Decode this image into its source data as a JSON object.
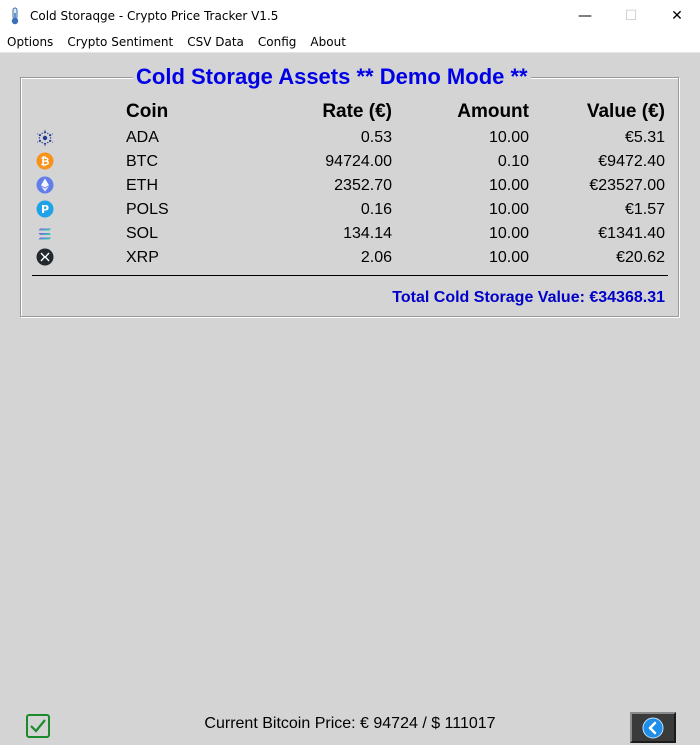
{
  "window": {
    "title": "Cold Storaqge - Crypto Price Tracker V1.5",
    "minimize": "—",
    "maximize": "☐",
    "close": "✕"
  },
  "menu": [
    "Options",
    "Crypto Sentiment",
    "CSV Data",
    "Config",
    "About"
  ],
  "frame_title": "Cold Storage Assets ** Demo Mode **",
  "headers": {
    "coin": "Coin",
    "rate": "Rate (€)",
    "amount": "Amount",
    "value": "Value (€)"
  },
  "rows": [
    {
      "icon": "ada-icon",
      "coin": "ADA",
      "rate": "0.53",
      "amount": "10.00",
      "value": "€5.31"
    },
    {
      "icon": "btc-icon",
      "coin": "BTC",
      "rate": "94724.00",
      "amount": "0.10",
      "value": "€9472.40"
    },
    {
      "icon": "eth-icon",
      "coin": "ETH",
      "rate": "2352.70",
      "amount": "10.00",
      "value": "€23527.00"
    },
    {
      "icon": "pols-icon",
      "coin": "POLS",
      "rate": "0.16",
      "amount": "10.00",
      "value": "€1.57"
    },
    {
      "icon": "sol-icon",
      "coin": "SOL",
      "rate": "134.14",
      "amount": "10.00",
      "value": "€1341.40"
    },
    {
      "icon": "xrp-icon",
      "coin": "XRP",
      "rate": "2.06",
      "amount": "10.00",
      "value": "€20.62"
    }
  ],
  "total": "Total Cold Storage Value: €34368.31",
  "status": "Current Bitcoin Price: € 94724 / $ 111017",
  "colors": {
    "title_blue": "#0000e6",
    "total_blue": "#0000c8",
    "btc_orange": "#f7931a",
    "eth_purple": "#627eea",
    "pols_blue": "#1fa3e8",
    "check_green": "#1a8a2a"
  }
}
